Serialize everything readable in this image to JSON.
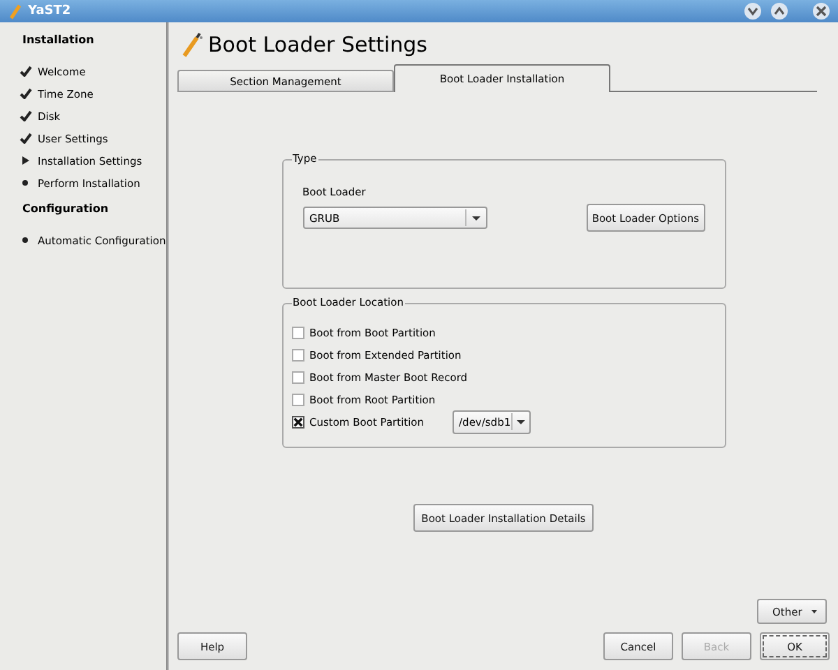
{
  "window": {
    "title": "YaST2"
  },
  "sidebar": {
    "sections": [
      {
        "heading": "Installation",
        "items": [
          {
            "label": "Welcome",
            "kind": "done"
          },
          {
            "label": "Time Zone",
            "kind": "done"
          },
          {
            "label": "Disk",
            "kind": "done"
          },
          {
            "label": "User Settings",
            "kind": "done"
          },
          {
            "label": "Installation Settings",
            "kind": "current"
          },
          {
            "label": "Perform Installation",
            "kind": "pending"
          }
        ]
      },
      {
        "heading": "Configuration",
        "items": [
          {
            "label": "Automatic Configuration",
            "kind": "pending"
          }
        ]
      }
    ]
  },
  "title": "Boot Loader Settings",
  "tabs": [
    {
      "label": "Section Management",
      "selected": false
    },
    {
      "label": "Boot Loader Installation",
      "selected": true
    }
  ],
  "type_group": {
    "legend": "Type",
    "field_label": "Boot Loader",
    "value": "GRUB",
    "options_button": "Boot Loader Options"
  },
  "location_group": {
    "legend": "Boot Loader Location",
    "options": [
      {
        "label": "Boot from Boot Partition",
        "checked": false
      },
      {
        "label": "Boot from Extended Partition",
        "checked": false
      },
      {
        "label": "Boot from Master Boot Record",
        "checked": false
      },
      {
        "label": "Boot from Root Partition",
        "checked": false
      },
      {
        "label": "Custom Boot Partition",
        "checked": true,
        "device": "/dev/sdb1"
      }
    ]
  },
  "details_button": "Boot Loader Installation Details",
  "other_button": "Other",
  "buttons": [
    {
      "label": "Help",
      "kind": "help",
      "disabled": false
    },
    {
      "label": "Cancel",
      "kind": "normal",
      "disabled": false
    },
    {
      "label": "Back",
      "kind": "normal",
      "disabled": true
    },
    {
      "label": "OK",
      "kind": "default",
      "disabled": false
    }
  ]
}
